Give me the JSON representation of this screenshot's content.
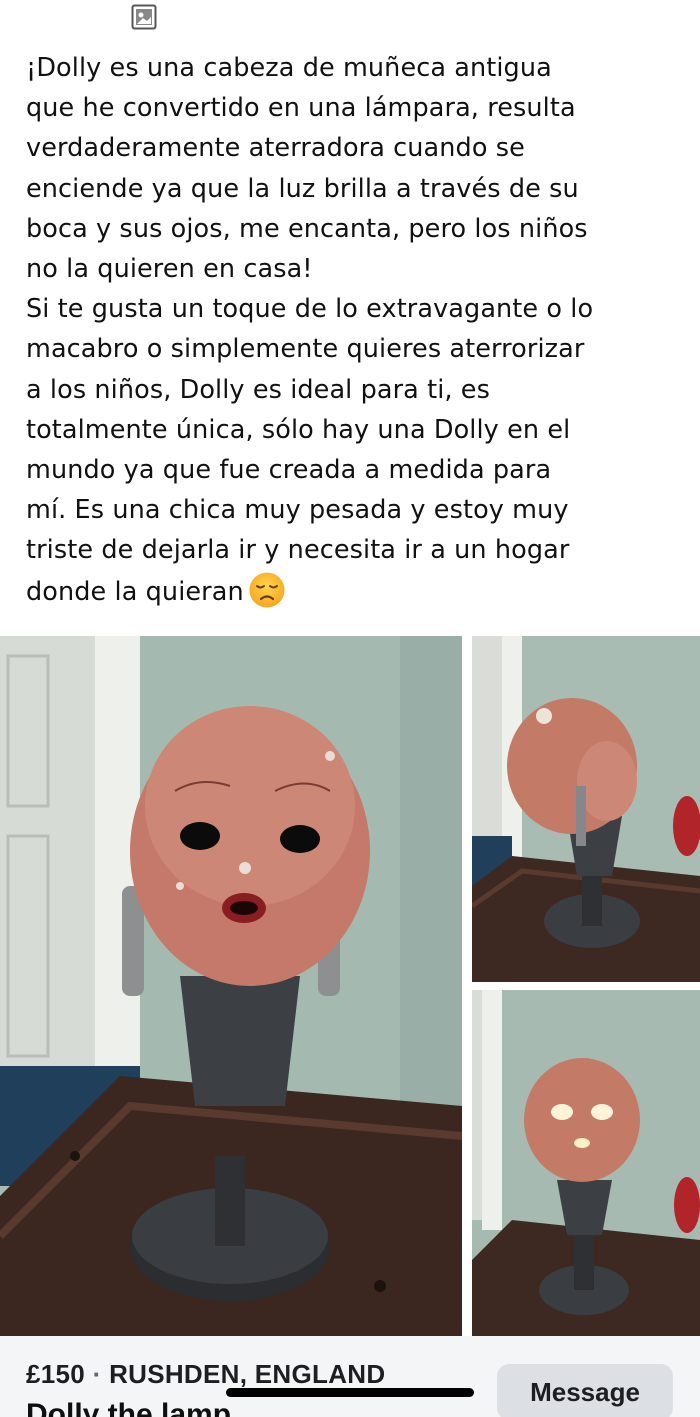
{
  "header": {
    "icon": "image-frame-icon"
  },
  "post": {
    "description": "¡Dolly es una cabeza de muñeca antigua\nque  he convertido en una lámpara, resulta\nverdaderamente aterradora cuando se\nenciende ya que la luz brilla a través de su\nboca y sus ojos, me encanta, pero los niños\nno la quieren en casa!\nSi te gusta un toque de lo extravagante o lo\nmacabro o simplemente quieres aterrorizar\na los niños, Dolly es ideal para ti, es\ntotalmente única, sólo hay una Dolly en el\nmundo ya que fue creada a medida para\nmí. Es una chica muy pesada y estoy muy\ntriste de dejarla ir y necesita ir a un hogar\ndonde la quieran",
    "emoji": "disappointed-face-icon"
  },
  "gallery": {
    "photos": [
      "doll-head-lamp-front",
      "doll-head-lamp-side",
      "doll-head-lamp-lit"
    ]
  },
  "listing": {
    "price": "£150",
    "separator": " · ",
    "location": "RUSHDEN, ENGLAND",
    "title": "Dolly the lamp",
    "message_button": "Message"
  },
  "colors": {
    "footer_bg": "#f4f5f7",
    "button_bg": "#dcdfe4",
    "text": "#1c1e21"
  }
}
